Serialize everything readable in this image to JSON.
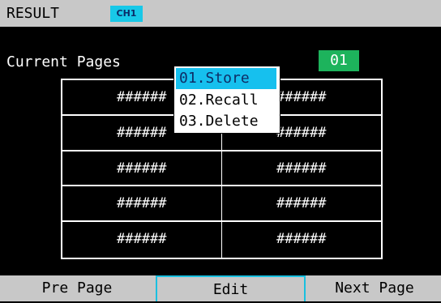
{
  "header": {
    "title": "RESULT",
    "channel": "CH1"
  },
  "pages": {
    "label": "Current Pages",
    "number": "01"
  },
  "grid": {
    "rows": [
      {
        "left": "######",
        "right": "######"
      },
      {
        "left": "######",
        "right": "######"
      },
      {
        "left": "######",
        "right": "######"
      },
      {
        "left": "######",
        "right": "######"
      },
      {
        "left": "######",
        "right": "######"
      }
    ]
  },
  "menu": {
    "items": [
      "01.Store",
      "02.Recall",
      "03.Delete"
    ],
    "selected_index": 0
  },
  "footer": {
    "pre_page": "Pre Page",
    "edit": "Edit",
    "next_page": "Next Page"
  },
  "colors": {
    "header_bg": "#c8c8c8",
    "channel_badge": "#18c8e8",
    "page_number_bg": "#1db35c",
    "menu_selected": "#16c0ee"
  }
}
